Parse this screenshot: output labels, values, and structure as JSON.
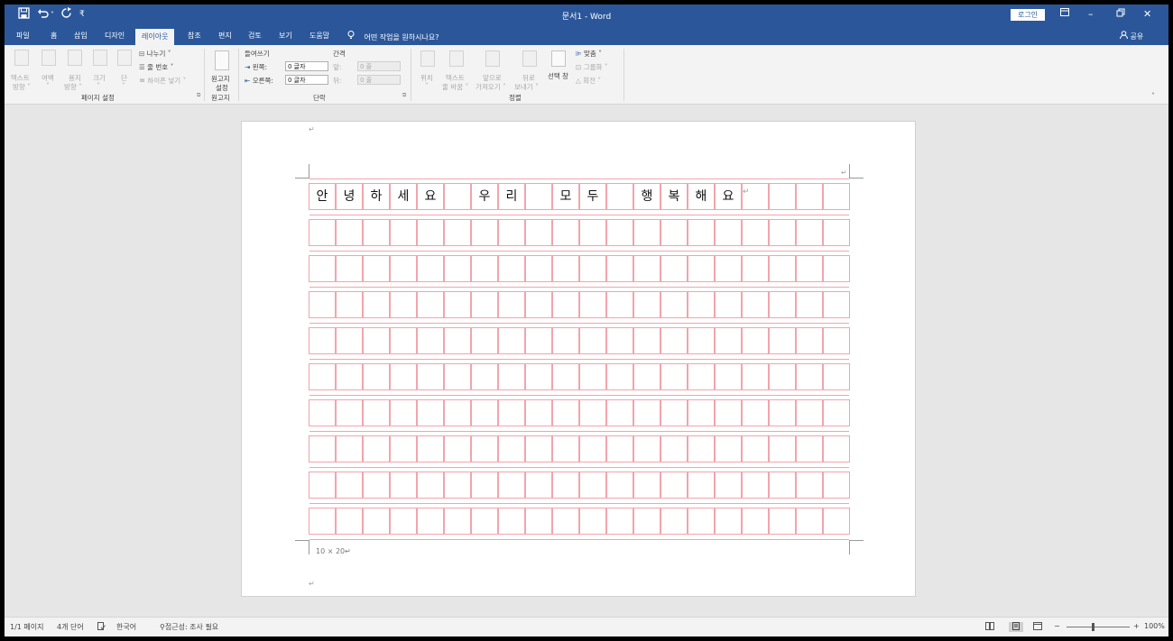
{
  "title_bar": {
    "quick_access": {
      "save_icon": "save-icon",
      "undo_icon": "undo-icon",
      "redo_icon": "redo-icon"
    },
    "document_title": "문서1 - Word",
    "login_label": "로그인"
  },
  "tabs": [
    {
      "label": "파일"
    },
    {
      "label": "홈"
    },
    {
      "label": "삽입"
    },
    {
      "label": "디자인"
    },
    {
      "label": "레이아웃",
      "active": true
    },
    {
      "label": "참조"
    },
    {
      "label": "편지"
    },
    {
      "label": "검토"
    },
    {
      "label": "보기"
    },
    {
      "label": "도움말"
    }
  ],
  "tell_me": "어떤 작업을 원하시나요?",
  "share_label": "공유",
  "ribbon": {
    "page_setup": {
      "group_label": "페이지 설정",
      "text_direction": [
        "텍스트",
        "방향 ˅"
      ],
      "margins": [
        "여백",
        "˅"
      ],
      "orientation": [
        "용지",
        "방향 ˅"
      ],
      "size": [
        "크기",
        "˅"
      ],
      "columns": [
        "단",
        "˅"
      ],
      "breaks": "나누기 ˅",
      "line_numbers": "줄 번호 ˅",
      "hyphenation": "하이픈 넣기 ˅"
    },
    "manuscript": {
      "group_label": "원고지",
      "button": [
        "원고지",
        "설정"
      ]
    },
    "paragraph": {
      "group_label": "단락",
      "indent_label": "들여쓰기",
      "spacing_label": "간격",
      "left_label": "왼쪽:",
      "right_label": "오른쪽:",
      "left_value": "0 글자",
      "right_value": "0 글자",
      "before_label": "앞:",
      "after_label": "뒤:",
      "before_value": "0 줄",
      "after_value": "0 줄"
    },
    "arrange": {
      "group_label": "정렬",
      "position": [
        "위치",
        "˅"
      ],
      "wrap_text": [
        "텍스트",
        "줄 바꿈 ˅"
      ],
      "bring_forward": [
        "앞으로",
        "가져오기 ˅"
      ],
      "send_backward": [
        "뒤로",
        "보내기 ˅"
      ],
      "selection_pane": "선택 창",
      "align": "맞춤 ˅",
      "group": "그룹화 ˅",
      "rotate": "회전 ˅"
    }
  },
  "document": {
    "grid_rows": 10,
    "grid_cols": 20,
    "first_row_text": [
      "안",
      "녕",
      "하",
      "세",
      "요",
      "",
      "우",
      "리",
      "",
      "모",
      "두",
      "",
      "행",
      "복",
      "해",
      "요",
      "",
      "",
      "",
      ""
    ],
    "paragraph_mark": "↵",
    "grid_size_label": "10 × 20↵"
  },
  "status_bar": {
    "page": "1/1 페이지",
    "words": "4개 단어",
    "language": "한국어",
    "accessibility": "접근성: 조사 필요",
    "zoom": "100%",
    "zoom_minus": "−",
    "zoom_plus": "+"
  },
  "colors": {
    "brand": "#2b579a",
    "grid_line": "#f2a4ac",
    "page": "#ffffff"
  }
}
